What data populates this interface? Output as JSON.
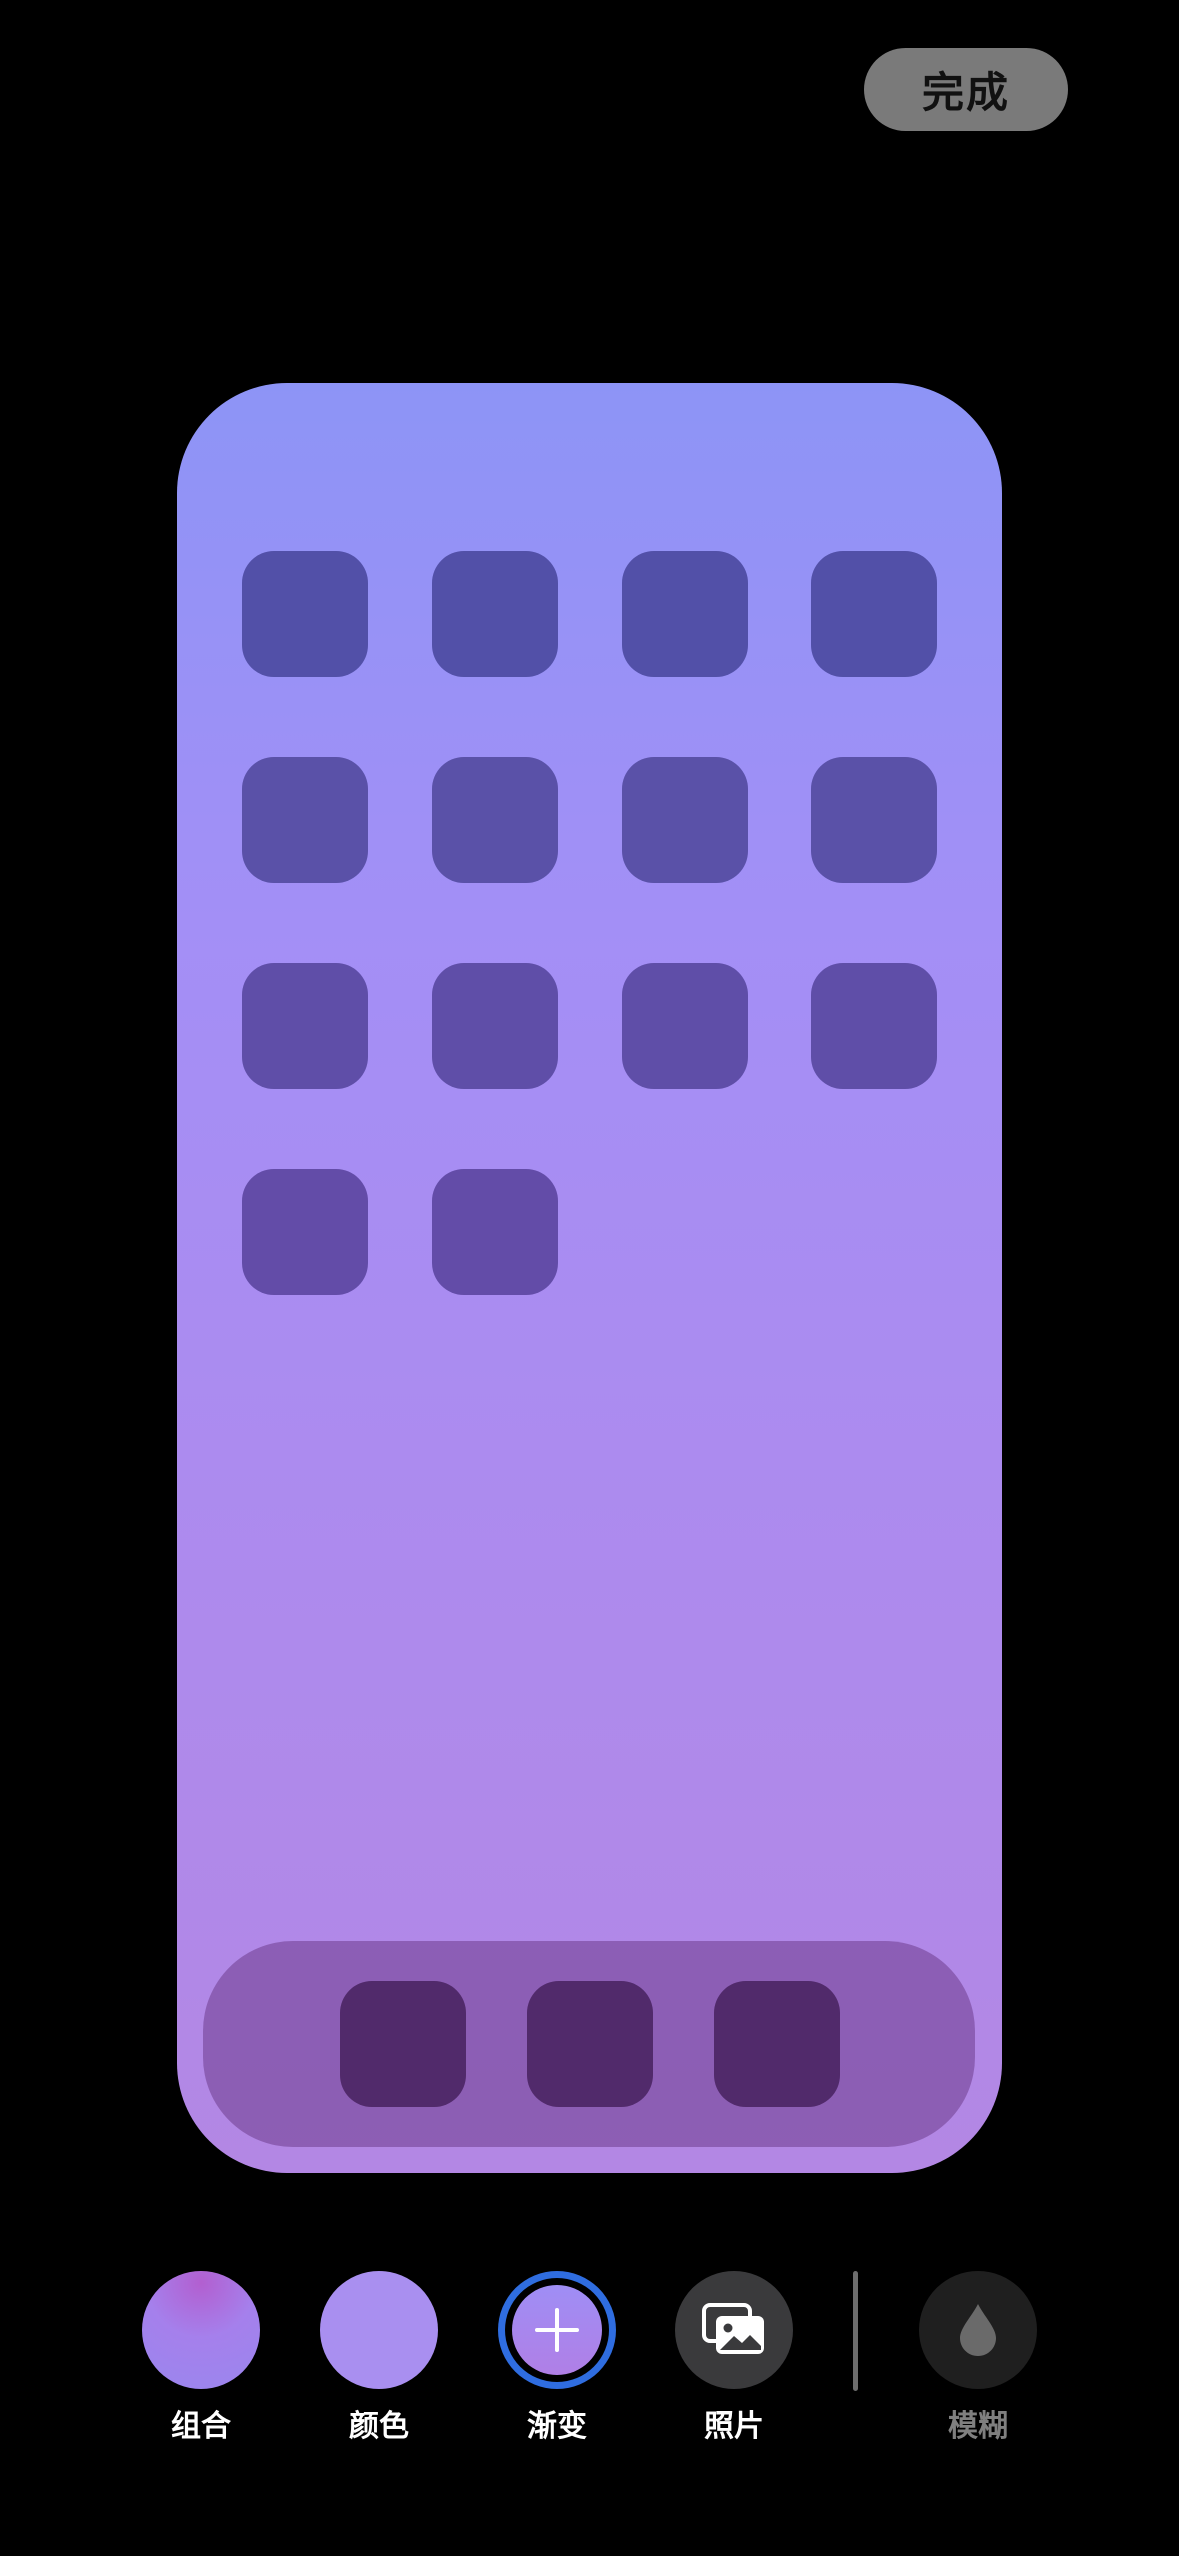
{
  "header": {
    "done_label": "完成"
  },
  "wallpaper_preview": {
    "gradient_top": "#8d94f6",
    "gradient_bottom": "#b387e4",
    "app_icon_color_top": "#5250a8",
    "app_icon_color_bottom": "#634ca8",
    "dock_icon_color": "#512a6b"
  },
  "options": {
    "items": [
      {
        "label": "组合",
        "icon": "combo-swatch"
      },
      {
        "label": "颜色",
        "icon": "color-swatch"
      },
      {
        "label": "渐变",
        "icon": "add-gradient-icon",
        "selected": true
      },
      {
        "label": "照片",
        "icon": "photos-icon"
      },
      {
        "label": "模糊",
        "icon": "blur-drop-icon",
        "disabled": true
      }
    ],
    "accent_color": "#2f6de0"
  }
}
